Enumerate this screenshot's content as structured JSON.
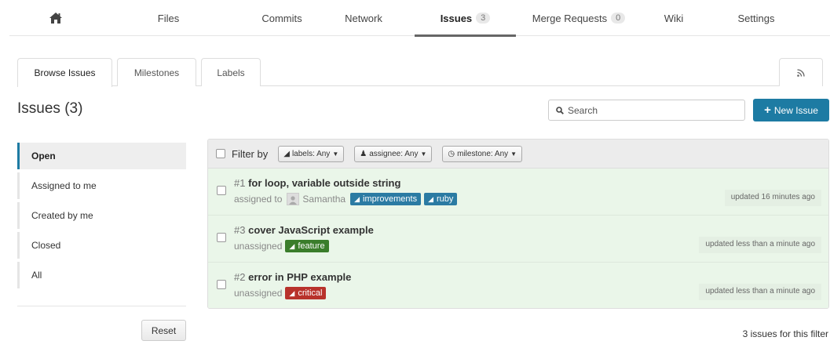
{
  "nav": {
    "files": "Files",
    "commits": "Commits",
    "network": "Network",
    "issues": "Issues",
    "issues_count": "3",
    "merge_requests": "Merge Requests",
    "merge_requests_count": "0",
    "wiki": "Wiki",
    "settings": "Settings"
  },
  "tabs": {
    "browse": "Browse Issues",
    "milestones": "Milestones",
    "labels": "Labels"
  },
  "page_title": "Issues (3)",
  "search": {
    "placeholder": "Search"
  },
  "new_issue_label": "New Issue",
  "sidebar": {
    "items": [
      {
        "label": "Open"
      },
      {
        "label": "Assigned to me"
      },
      {
        "label": "Created by me"
      },
      {
        "label": "Closed"
      },
      {
        "label": "All"
      }
    ],
    "reset_label": "Reset"
  },
  "filter": {
    "label": "Filter by",
    "labels": "labels: Any",
    "assignee": "assignee: Any",
    "milestone": "milestone: Any"
  },
  "issues": [
    {
      "number": "#1",
      "title": "for loop, variable outside string",
      "assign_prefix": "assigned to",
      "assignee": "Samantha",
      "labels": [
        {
          "name": "improvements",
          "color": "#2b7ba3"
        },
        {
          "name": "ruby",
          "color": "#2b7ba3"
        }
      ],
      "updated": "updated 16 minutes ago"
    },
    {
      "number": "#3",
      "title": "cover JavaScript example",
      "assign_prefix": "unassigned",
      "labels": [
        {
          "name": "feature",
          "color": "#3a7d2b"
        }
      ],
      "updated": "updated less than a minute ago"
    },
    {
      "number": "#2",
      "title": "error in PHP example",
      "assign_prefix": "unassigned",
      "labels": [
        {
          "name": "critical",
          "color": "#b8322b"
        }
      ],
      "updated": "updated less than a minute ago"
    }
  ],
  "footer_count": "3 issues for this filter",
  "colors": {
    "accent": "#1d7ba3",
    "row_bg": "#eaf6e9"
  },
  "icons": [
    "home-icon",
    "rss-icon",
    "search-icon",
    "plus-icon",
    "tag-icon",
    "user-icon",
    "clock-icon",
    "caret-down-icon"
  ]
}
